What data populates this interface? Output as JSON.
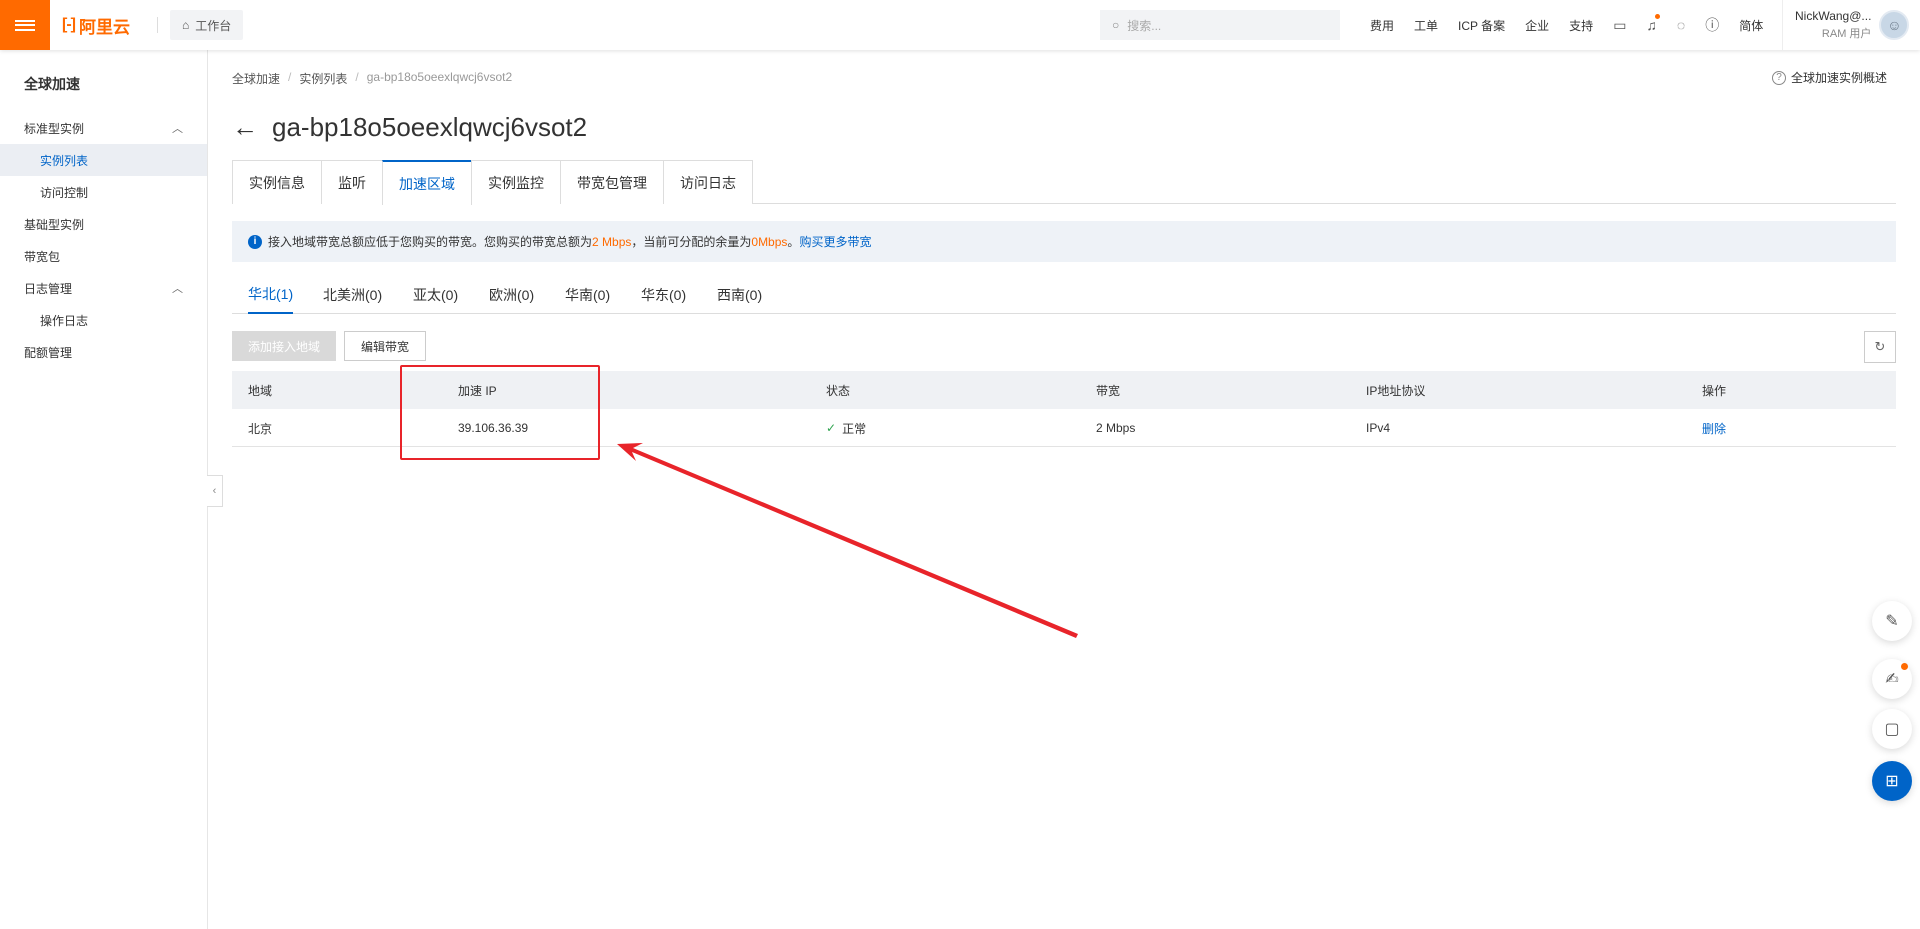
{
  "topbar": {
    "logo_mark": "[-]",
    "logo_text": "阿里云",
    "workbench": "工作台",
    "search_placeholder": "搜索...",
    "links": [
      "费用",
      "工单",
      "ICP 备案",
      "企业",
      "支持"
    ],
    "lang": "简体",
    "user_name": "NickWang@...",
    "user_role": "RAM 用户"
  },
  "sidebar": {
    "title": "全球加速",
    "items": [
      {
        "label": "标准型实例",
        "chevron": "︿"
      },
      {
        "label": "实例列表"
      },
      {
        "label": "访问控制"
      },
      {
        "label": "基础型实例"
      },
      {
        "label": "带宽包"
      },
      {
        "label": "日志管理",
        "chevron": "︿"
      },
      {
        "label": "操作日志"
      },
      {
        "label": "配额管理"
      }
    ]
  },
  "breadcrumb": [
    "全球加速",
    "实例列表",
    "ga-bp18o5oeexlqwcj6vsot2"
  ],
  "overview_link": "全球加速实例概述",
  "page_title": "ga-bp18o5oeexlqwcj6vsot2",
  "tabs": [
    "实例信息",
    "监听",
    "加速区域",
    "实例监控",
    "带宽包管理",
    "访问日志"
  ],
  "active_tab": "加速区域",
  "notice": {
    "part1": "接入地域带宽总额应低于您购买的带宽。您购买的带宽总额为",
    "bw_total": "2 Mbps",
    "part2": "，当前可分配的余量为",
    "bw_left": "0Mbps",
    "part3": "。",
    "link": "购买更多带宽"
  },
  "region_tabs": [
    "华北(1)",
    "北美洲(0)",
    "亚太(0)",
    "欧洲(0)",
    "华南(0)",
    "华东(0)",
    "西南(0)"
  ],
  "buttons": {
    "add_region": "添加接入地域",
    "edit_bandwidth": "编辑带宽"
  },
  "table": {
    "headers": [
      "地域",
      "加速 IP",
      "状态",
      "带宽",
      "IP地址协议",
      "操作"
    ],
    "rows": [
      {
        "region": "北京",
        "ip": "39.106.36.39",
        "status": "正常",
        "bandwidth": "2 Mbps",
        "protocol": "IPv4",
        "action": "删除"
      }
    ]
  },
  "colors": {
    "brand": "#ff6a00",
    "accent": "#0064c8",
    "annotation": "#e8242a",
    "status_ok": "#2fa44f"
  },
  "icons": [
    "menu-icon",
    "home-icon",
    "search-icon",
    "terminal-icon",
    "bell-icon",
    "bulb-icon",
    "help-icon",
    "info-icon",
    "check-icon",
    "refresh-icon",
    "back-arrow-icon",
    "edit-icon",
    "feedback-icon",
    "chat-icon",
    "apps-icon"
  ]
}
